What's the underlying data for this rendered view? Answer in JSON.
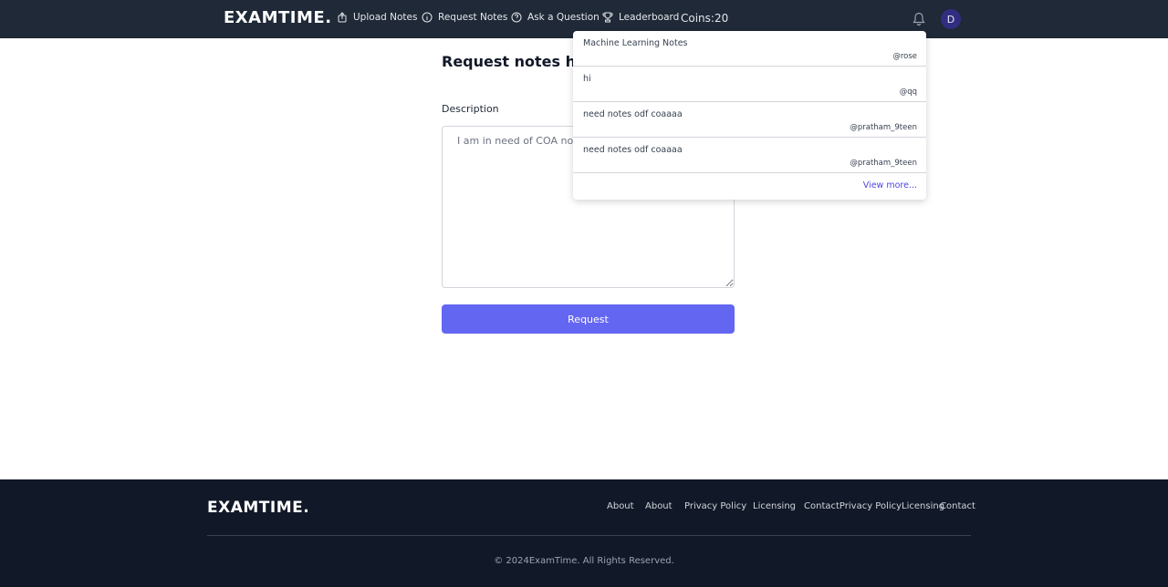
{
  "navbar": {
    "logo": "EXAMTIME.",
    "items": [
      {
        "label": "Upload Notes",
        "icon": "upload-icon"
      },
      {
        "label": "Request Notes",
        "icon": "info-icon"
      },
      {
        "label": "Ask a Question",
        "icon": "question-icon"
      },
      {
        "label": "Leaderboard",
        "icon": "trophy-icon"
      }
    ],
    "coins": "Coins:20",
    "avatar_initial": "D"
  },
  "main": {
    "title": "Request notes here.",
    "description_label": "Description",
    "description_placeholder": "I am in need of COA notes",
    "request_button": "Request"
  },
  "dropdown": {
    "items": [
      {
        "title": "Machine Learning Notes",
        "user": "@rose"
      },
      {
        "title": "hi",
        "user": "@qq"
      },
      {
        "title": "need notes odf coaaaa",
        "user": "@pratham_9teen"
      },
      {
        "title": "need notes odf coaaaa",
        "user": "@pratham_9teen"
      }
    ],
    "view_more": "View more..."
  },
  "footer": {
    "logo": "EXAMTIME.",
    "links": [
      "About",
      "About",
      "Privacy Policy",
      "Licensing",
      "ContactPrivacy PolicyLicensing",
      "Contact"
    ],
    "copyright": "© 2024ExamTime. All Rights Reserved."
  }
}
